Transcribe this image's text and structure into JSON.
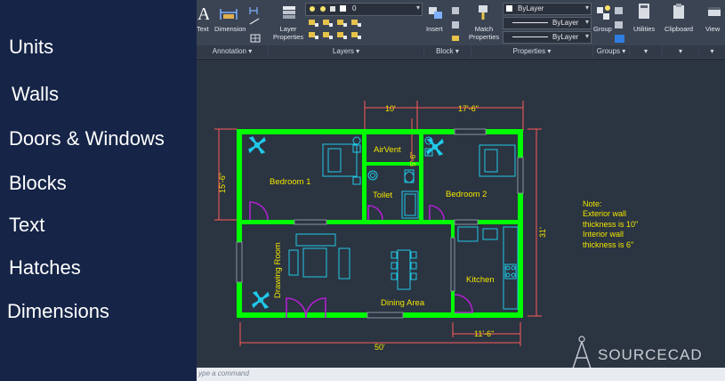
{
  "sidebar": {
    "items": [
      {
        "label": "Units"
      },
      {
        "label": "Walls"
      },
      {
        "label": "Doors & Windows"
      },
      {
        "label": "Blocks"
      },
      {
        "label": "Text"
      },
      {
        "label": "Hatches"
      },
      {
        "label": "Dimensions"
      }
    ]
  },
  "ribbon": {
    "annotation": {
      "text_label": "Text",
      "dimension_label": "Dimension",
      "title": "Annotation ▾"
    },
    "layers": {
      "layer_properties_label": "Layer\nProperties",
      "layer_value": "0",
      "title": "Layers ▾"
    },
    "block": {
      "insert_label": "Insert",
      "title": "Block ▾"
    },
    "properties": {
      "match_label": "Match\nProperties",
      "color_value": "ByLayer",
      "linetype_value": "ByLayer",
      "lineweight_value": "ByLayer",
      "title": "Properties ▾"
    },
    "groups": {
      "group_label": "Group",
      "title": "Groups ▾"
    },
    "utilities": {
      "label": "Utilities"
    },
    "clipboard": {
      "label": "Clipboard"
    },
    "view": {
      "label": "View"
    }
  },
  "drawing": {
    "dims": {
      "top_left": "10'",
      "top_right": "17'-6\"",
      "left": "15'-6\"",
      "right": "31'",
      "bottom": "50'",
      "bottom_right": "11'-6\"",
      "airvent_dim": "5'-6\""
    },
    "rooms": {
      "bedroom1": "Bedroom  1",
      "bedroom2": "Bedroom  2",
      "toilet": "Toilet",
      "airvent": "AirVent",
      "drawing_room": "Drawing Room",
      "dining": "Dining  Area",
      "kitchen": "Kitchen"
    },
    "note": [
      "Note:",
      "Exterior wall",
      "thickness is 10\"",
      "Interior wall",
      "thickness is 6\""
    ]
  },
  "command_line": {
    "placeholder": "ype a command"
  },
  "logo": {
    "text": "SOURCECAD"
  },
  "colors": {
    "wall": "#00ff00",
    "dim": "#ff5a5a",
    "fixture": "#20c8e8",
    "door": "#a020c0",
    "label": "#f2e600",
    "sidebar_bg": "#152447"
  }
}
